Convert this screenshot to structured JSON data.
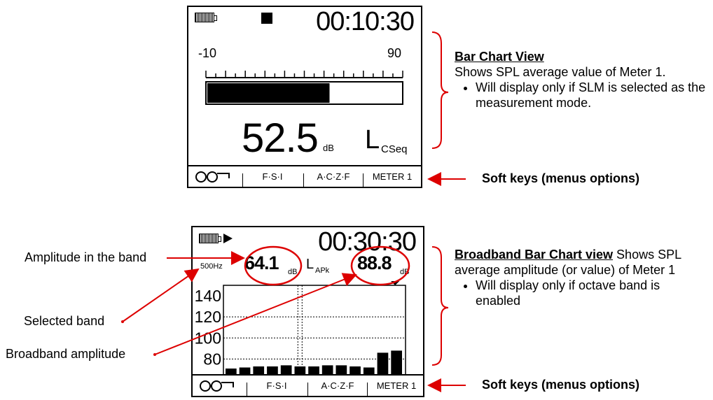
{
  "screen1": {
    "time": "00:10:30",
    "scale_min": "-10",
    "scale_max": "90",
    "bar_fraction": 0.63,
    "value": "52.5",
    "unit": "dB",
    "mode_L": "L",
    "mode_sub": "CSeq",
    "softkeys": [
      "F·S·I",
      "A·C·Z·F",
      "METER 1"
    ]
  },
  "screen2": {
    "time": "00:30:30",
    "band_freq": "500Hz",
    "band_value": "64.1",
    "band_unit": "dB",
    "mode_L": "L",
    "mode_sub": "APk",
    "broadband_value": "88.8",
    "broadband_unit": "dB",
    "y_ticks": [
      "140",
      "120",
      "100",
      "80"
    ],
    "softkeys": [
      "F·S·I",
      "A·C·Z·F",
      "METER 1"
    ]
  },
  "notes": {
    "bar_chart_title": "Bar Chart View",
    "bar_chart_desc": "Shows SPL average value of Meter 1.",
    "bar_chart_bullet": "Will display only if SLM is selected as the measurement mode.",
    "broadband_title": "Broadband Bar Chart view",
    "broadband_desc_inline": " Shows SPL average amplitude (or value) of Meter 1",
    "broadband_bullet": "Will display only if octave band is enabled",
    "softkeys_label_1": "Soft keys (menus options)",
    "softkeys_label_2": "Soft keys (menus options)"
  },
  "annotations": {
    "amplitude_band": "Amplitude in the band",
    "selected_band": "Selected band",
    "broadband_amplitude": "Broadband amplitude"
  },
  "chart_data": {
    "type": "bar",
    "title": "",
    "ylim": [
      65,
      150
    ],
    "yticks": [
      80,
      100,
      120,
      140
    ],
    "grid": true,
    "values": [
      71,
      72,
      73,
      73,
      74,
      73,
      73,
      74,
      74,
      73,
      72,
      86,
      88
    ]
  }
}
